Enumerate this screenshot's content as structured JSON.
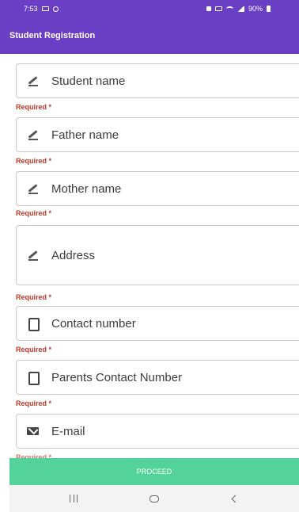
{
  "status_bar": {
    "time": "7:53",
    "battery": "90%"
  },
  "app_bar": {
    "title": "Student Registration"
  },
  "form": {
    "fields": [
      {
        "placeholder": "Student name",
        "icon": "pen-icon",
        "required_label": "Required *"
      },
      {
        "placeholder": "Father name",
        "icon": "pen-icon",
        "required_label": "Required *"
      },
      {
        "placeholder": "Mother name",
        "icon": "pen-icon",
        "required_label": "Required *"
      },
      {
        "placeholder": "Address",
        "icon": "pen-icon",
        "required_label": "Required *"
      },
      {
        "placeholder": "Contact number",
        "icon": "phone-icon",
        "required_label": "Required *"
      },
      {
        "placeholder": "Parents Contact Number",
        "icon": "phone-icon",
        "required_label": "Required *"
      },
      {
        "placeholder": "E-mail",
        "icon": "mail-icon",
        "required_label": "Required *"
      }
    ]
  },
  "proceed": {
    "label": "PROCEED"
  },
  "colors": {
    "primary": "#6a3fc3",
    "accent": "#53d39a",
    "error": "#c0392b"
  }
}
